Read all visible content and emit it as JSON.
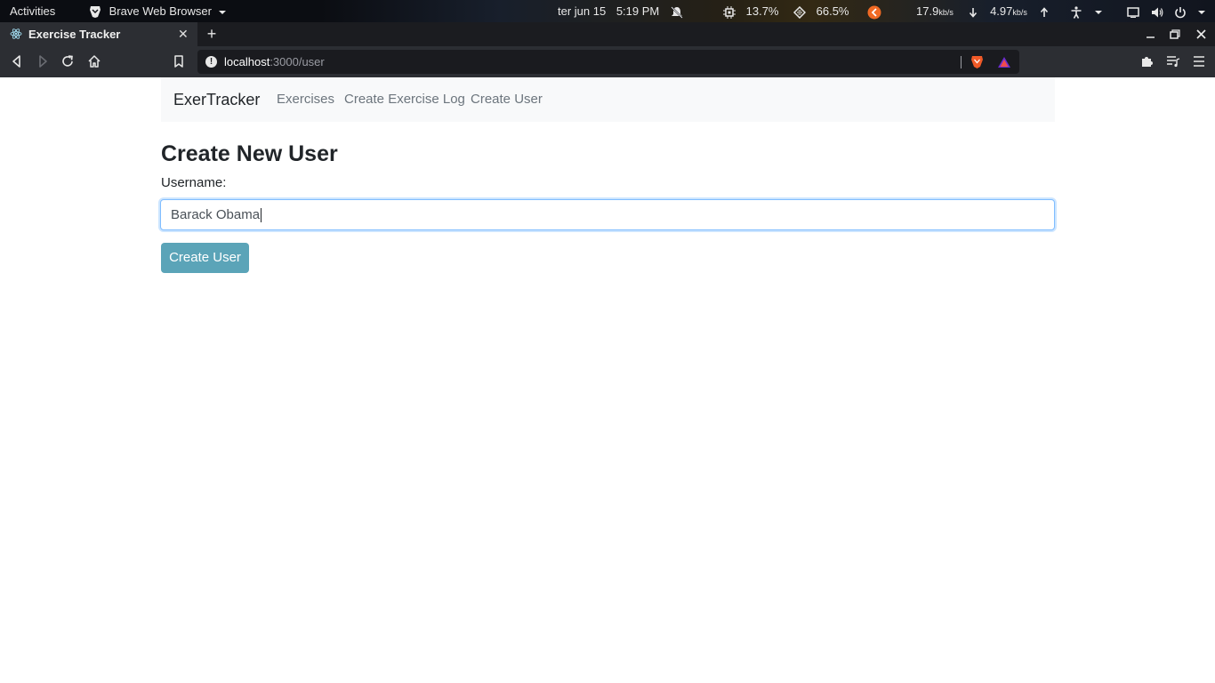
{
  "topbar": {
    "activities": "Activities",
    "app_name": "Brave Web Browser",
    "date": "ter jun 15",
    "time": "5:19 PM",
    "cpu": "13.7%",
    "mem": "66.5%",
    "net_down_value": "17.9",
    "net_down_unit": "kb/s",
    "net_up_value": "4.97",
    "net_up_unit": "kb/s"
  },
  "browser": {
    "tab_title": "Exercise Tracker",
    "tab_close": "✕",
    "new_tab": "+",
    "url_host": "localhost",
    "url_rest": ":3000/user",
    "icons": [
      "back-icon",
      "forward-icon",
      "reload-icon",
      "home-icon",
      "bookmark-icon",
      "site-info-icon",
      "brave-shields-icon",
      "brave-rewards-icon",
      "extensions-icon",
      "media-queue-icon",
      "menu-icon"
    ]
  },
  "navbar": {
    "brand": "ExerTracker",
    "links": [
      "Exercises",
      "Create Exercise Log",
      "Create User"
    ]
  },
  "form": {
    "heading": "Create New User",
    "username_label": "Username:",
    "username_value": "Barack Obama",
    "submit_label": "Create User"
  },
  "colors": {
    "button_bg": "#5ba4b8",
    "nav_bg": "#f8f9fa",
    "input_focus_border": "#80bdff",
    "browser_chrome": "#2c2e33"
  }
}
